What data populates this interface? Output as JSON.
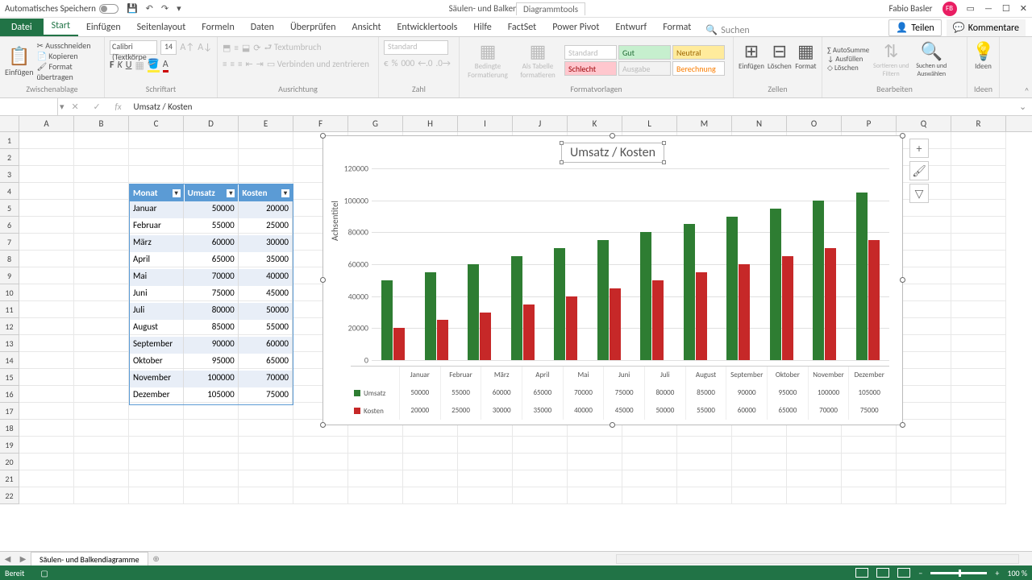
{
  "titlebar": {
    "autosave": "Automatisches Speichern",
    "doc": "Säulen- und Balkendiagramme - Excel",
    "tools": "Diagrammtools",
    "user": "Fabio Basler",
    "avatar": "FB"
  },
  "tabs": {
    "file": "Datei",
    "start": "Start",
    "einfuegen": "Einfügen",
    "seitenlayout": "Seitenlayout",
    "formeln": "Formeln",
    "daten": "Daten",
    "ueberpruefen": "Überprüfen",
    "ansicht": "Ansicht",
    "entwicklertools": "Entwicklertools",
    "hilfe": "Hilfe",
    "factset": "FactSet",
    "powerpivot": "Power Pivot",
    "entwurf": "Entwurf",
    "format": "Format",
    "suchen": "Suchen",
    "teilen": "Teilen",
    "kommentare": "Kommentare"
  },
  "ribbon": {
    "einfuegen": "Einfügen",
    "ausschneiden": "Ausschneiden",
    "kopieren": "Kopieren",
    "format_uebertragen": "Format übertragen",
    "zwischenablage": "Zwischenablage",
    "font_name": "Calibri (Textkörpe",
    "font_size": "14",
    "schriftart": "Schriftart",
    "textumbruch": "Textumbruch",
    "verbinden": "Verbinden und zentrieren",
    "ausrichtung": "Ausrichtung",
    "number_format": "Standard",
    "zahl": "Zahl",
    "bedingte": "Bedingte Formatierung",
    "als_tabelle": "Als Tabelle formatieren",
    "standard": "Standard",
    "gut": "Gut",
    "neutral": "Neutral",
    "schlecht": "Schlecht",
    "ausgabe": "Ausgabe",
    "berechnung": "Berechnung",
    "formatvorlagen": "Formatvorlagen",
    "zellen_einfuegen": "Einfügen",
    "zellen_loeschen": "Löschen",
    "zellen_format": "Format",
    "zellen": "Zellen",
    "autosumme": "AutoSumme",
    "ausfuellen": "Ausfüllen",
    "loeschen": "Löschen",
    "sortieren": "Sortieren und Filtern",
    "suchen_auswaehlen": "Suchen und Auswählen",
    "bearbeiten": "Bearbeiten",
    "ideen": "Ideen"
  },
  "formula": {
    "namebox": "",
    "value": "Umsatz / Kosten"
  },
  "columns": [
    "A",
    "B",
    "C",
    "D",
    "E",
    "F",
    "G",
    "H",
    "I",
    "J",
    "K",
    "L",
    "M",
    "N",
    "O",
    "P",
    "Q",
    "R"
  ],
  "row_count": 22,
  "table": {
    "h1": "Monat",
    "h2": "Umsatz",
    "h3": "Kosten",
    "rows": [
      {
        "m": "Januar",
        "u": "50000",
        "k": "20000"
      },
      {
        "m": "Februar",
        "u": "55000",
        "k": "25000"
      },
      {
        "m": "März",
        "u": "60000",
        "k": "30000"
      },
      {
        "m": "April",
        "u": "65000",
        "k": "35000"
      },
      {
        "m": "Mai",
        "u": "70000",
        "k": "40000"
      },
      {
        "m": "Juni",
        "u": "75000",
        "k": "45000"
      },
      {
        "m": "Juli",
        "u": "80000",
        "k": "50000"
      },
      {
        "m": "August",
        "u": "85000",
        "k": "55000"
      },
      {
        "m": "September",
        "u": "90000",
        "k": "60000"
      },
      {
        "m": "Oktober",
        "u": "95000",
        "k": "65000"
      },
      {
        "m": "November",
        "u": "100000",
        "k": "70000"
      },
      {
        "m": "Dezember",
        "u": "105000",
        "k": "75000"
      }
    ]
  },
  "chart_data": {
    "type": "bar",
    "title": "Umsatz / Kosten",
    "ylabel": "Achsentitel",
    "ylim": [
      0,
      120000
    ],
    "yticks": [
      0,
      20000,
      40000,
      60000,
      80000,
      100000,
      120000
    ],
    "categories": [
      "Januar",
      "Februar",
      "März",
      "April",
      "Mai",
      "Juni",
      "Juli",
      "August",
      "September",
      "Oktober",
      "November",
      "Dezember"
    ],
    "series": [
      {
        "name": "Umsatz",
        "values": [
          50000,
          55000,
          60000,
          65000,
          70000,
          75000,
          80000,
          85000,
          90000,
          95000,
          100000,
          105000
        ]
      },
      {
        "name": "Kosten",
        "values": [
          20000,
          25000,
          30000,
          35000,
          40000,
          45000,
          50000,
          55000,
          60000,
          65000,
          70000,
          75000
        ]
      }
    ]
  },
  "sheets": {
    "tab1": "Säulen- und Balkendiagramme"
  },
  "status": {
    "ready": "Bereit",
    "zoom": "100 %"
  }
}
